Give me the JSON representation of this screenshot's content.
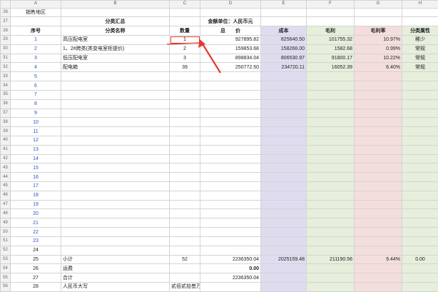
{
  "columns": [
    "",
    "A",
    "B",
    "C",
    "D",
    "E",
    "F",
    "G",
    "H"
  ],
  "rows": [
    {
      "n": "26",
      "cells": [
        "销售地区",
        "",
        "",
        "",
        "",
        "",
        "",
        ""
      ]
    },
    {
      "n": "27",
      "cells": [
        "",
        "分类汇总",
        "",
        "金额单位：人民币元",
        "",
        "",
        "",
        ""
      ]
    },
    {
      "n": "28",
      "cells": [
        "序号",
        "分类名称",
        "数量",
        "总　　价",
        "成本",
        "毛利",
        "毛利率",
        "分类属性"
      ]
    },
    {
      "n": "29",
      "cells": [
        "1",
        "高压配电室",
        "1",
        "927895.82",
        "825640.50",
        "101755.32",
        "10.97%",
        "稀少"
      ]
    },
    {
      "n": "30",
      "cells": [
        "2",
        "1、2#跨类(类变电室柜提价)",
        "2",
        "159853.68",
        "158266.00",
        "1582.68",
        "0.99%",
        "常规"
      ]
    },
    {
      "n": "31",
      "cells": [
        "3",
        "低压配电室",
        "3",
        "898834.04",
        "806530.97",
        "91800.17",
        "10.22%",
        "常规"
      ]
    },
    {
      "n": "32",
      "cells": [
        "4",
        "配电箱",
        "39",
        "250772.50",
        "234720.11",
        "16052.39",
        "6.40%",
        "常规"
      ]
    },
    {
      "n": "33",
      "cells": [
        "5",
        "",
        "",
        "",
        "",
        "",
        "",
        ""
      ]
    },
    {
      "n": "34",
      "cells": [
        "6",
        "",
        "",
        "",
        "",
        "",
        "",
        ""
      ]
    },
    {
      "n": "35",
      "cells": [
        "7",
        "",
        "",
        "",
        "",
        "",
        "",
        ""
      ]
    },
    {
      "n": "36",
      "cells": [
        "8",
        "",
        "",
        "",
        "",
        "",
        "",
        ""
      ]
    },
    {
      "n": "37",
      "cells": [
        "9",
        "",
        "",
        "",
        "",
        "",
        "",
        ""
      ]
    },
    {
      "n": "38",
      "cells": [
        "10",
        "",
        "",
        "",
        "",
        "",
        "",
        ""
      ]
    },
    {
      "n": "39",
      "cells": [
        "11",
        "",
        "",
        "",
        "",
        "",
        "",
        ""
      ]
    },
    {
      "n": "40",
      "cells": [
        "12",
        "",
        "",
        "",
        "",
        "",
        "",
        ""
      ]
    },
    {
      "n": "41",
      "cells": [
        "13",
        "",
        "",
        "",
        "",
        "",
        "",
        ""
      ]
    },
    {
      "n": "42",
      "cells": [
        "14",
        "",
        "",
        "",
        "",
        "",
        "",
        ""
      ]
    },
    {
      "n": "43",
      "cells": [
        "15",
        "",
        "",
        "",
        "",
        "",
        "",
        ""
      ]
    },
    {
      "n": "44",
      "cells": [
        "16",
        "",
        "",
        "",
        "",
        "",
        "",
        ""
      ]
    },
    {
      "n": "45",
      "cells": [
        "17",
        "",
        "",
        "",
        "",
        "",
        "",
        ""
      ]
    },
    {
      "n": "46",
      "cells": [
        "18",
        "",
        "",
        "",
        "",
        "",
        "",
        ""
      ]
    },
    {
      "n": "47",
      "cells": [
        "19",
        "",
        "",
        "",
        "",
        "",
        "",
        ""
      ]
    },
    {
      "n": "48",
      "cells": [
        "20",
        "",
        "",
        "",
        "",
        "",
        "",
        ""
      ]
    },
    {
      "n": "49",
      "cells": [
        "21",
        "",
        "",
        "",
        "",
        "",
        "",
        ""
      ]
    },
    {
      "n": "50",
      "cells": [
        "22",
        "",
        "",
        "",
        "",
        "",
        "",
        ""
      ]
    },
    {
      "n": "51",
      "cells": [
        "23",
        "",
        "",
        "",
        "",
        "",
        "",
        ""
      ]
    },
    {
      "n": "52",
      "cells": [
        "24",
        "",
        "",
        "",
        "",
        "",
        "",
        ""
      ]
    },
    {
      "n": "53",
      "cells": [
        "25",
        "小计",
        "52",
        "2236350.04",
        "2025159.48",
        "211190.56",
        "9.44%",
        "0.00"
      ]
    },
    {
      "n": "54",
      "cells": [
        "26",
        "运费",
        "",
        "0.00",
        "",
        "",
        "",
        ""
      ]
    },
    {
      "n": "55",
      "cells": [
        "27",
        "合计",
        "",
        "2236350.04",
        "",
        "",
        "",
        ""
      ]
    },
    {
      "n": "56",
      "cells": [
        "28",
        "人民币大写",
        "贰佰贰拾叁万陆仟叁佰伍拾元零肆分",
        "",
        "",
        "",
        "",
        ""
      ]
    }
  ],
  "colors": {
    "purple": "#e0dcef",
    "green": "#e5efdb",
    "red": "#f4dedd",
    "highlight": "#e23a2e",
    "link": "#3050c8"
  }
}
